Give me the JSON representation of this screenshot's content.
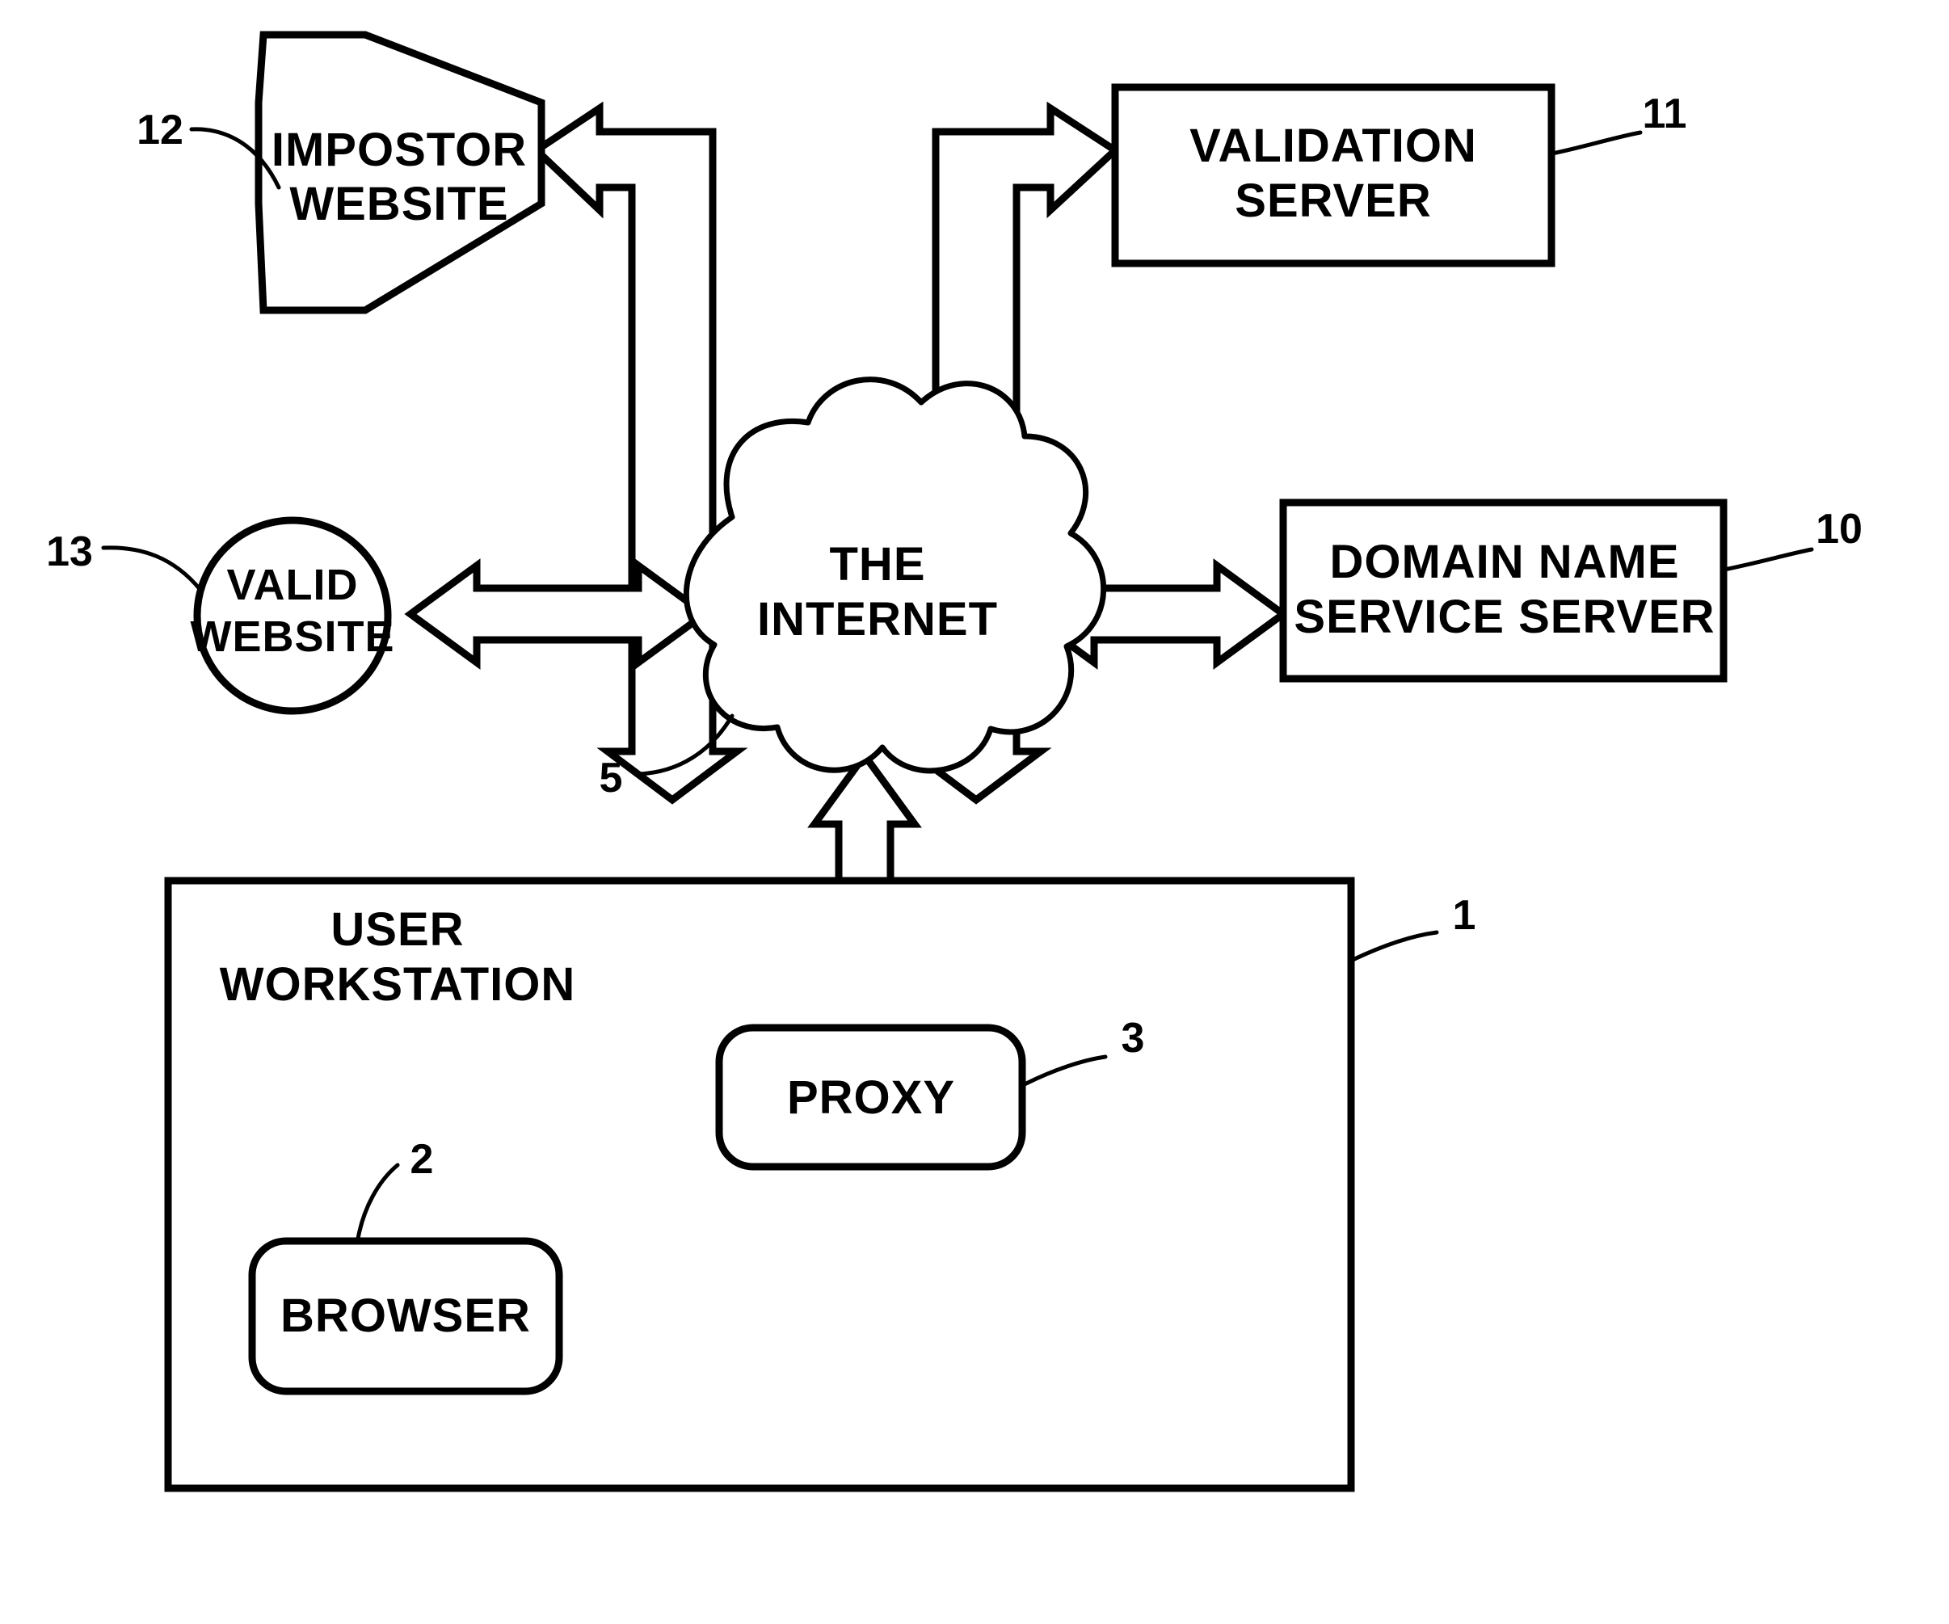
{
  "figure": {
    "type": "patent-diagram",
    "background": "#ffffff",
    "line_color": "#000000"
  },
  "nodes": {
    "impostor_website": {
      "label_line1": "IMPOSTOR",
      "label_line2": "WEBSITE",
      "ref": "12",
      "shape": "octagon"
    },
    "validation_server": {
      "label_line1": "VALIDATION",
      "label_line2": "SERVER",
      "ref": "11",
      "shape": "rectangle"
    },
    "valid_website": {
      "label_line1": "VALID",
      "label_line2": "WEBSITE",
      "ref": "13",
      "shape": "circle"
    },
    "internet": {
      "label_line1": "THE",
      "label_line2": "INTERNET",
      "ref": "5",
      "shape": "cloud"
    },
    "dns_server": {
      "label_line1": "DOMAIN  NAME",
      "label_line2": "SERVICE  SERVER",
      "ref": "10",
      "shape": "rectangle"
    },
    "user_workstation": {
      "label_line1": "USER",
      "label_line2": "WORKSTATION",
      "ref": "1",
      "shape": "rectangle"
    },
    "proxy": {
      "label_line1": "PROXY",
      "ref": "3",
      "shape": "rounded-rectangle"
    },
    "browser": {
      "label_line1": "BROWSER",
      "ref": "2",
      "shape": "rounded-rectangle"
    }
  },
  "connectors": [
    {
      "name": "impostor-to-internet",
      "from": "internet",
      "to": "impostor_website",
      "style": "hollow-block-elbow",
      "heads": "both"
    },
    {
      "name": "internet-to-validation-server",
      "from": "internet",
      "to": "validation_server",
      "style": "hollow-block-elbow",
      "heads": "both"
    },
    {
      "name": "valid-website-to-internet",
      "from": "valid_website",
      "to": "internet",
      "style": "hollow-block-straight",
      "heads": "both"
    },
    {
      "name": "internet-to-dns-server",
      "from": "internet",
      "to": "dns_server",
      "style": "hollow-block-straight",
      "heads": "both"
    },
    {
      "name": "internet-to-proxy",
      "from": "internet",
      "to": "proxy",
      "style": "hollow-block-straight-vertical",
      "heads": "both"
    },
    {
      "name": "proxy-to-browser",
      "from": "proxy",
      "to": "browser",
      "style": "thin-line-elbow",
      "heads": "both"
    }
  ]
}
